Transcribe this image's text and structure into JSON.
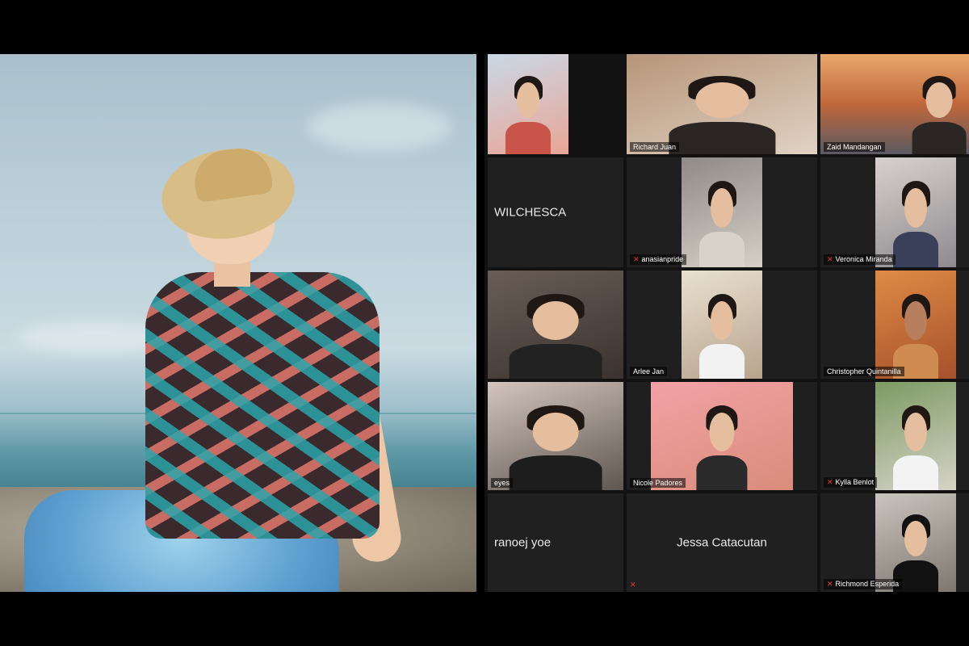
{
  "zoom": {
    "tiles": [
      {
        "id": "t1",
        "label": "",
        "mode": "video"
      },
      {
        "id": "t2",
        "label": "Richard Juan",
        "mode": "video"
      },
      {
        "id": "t3",
        "label": "Zaid Mandangan",
        "mode": "video"
      },
      {
        "id": "t4",
        "label": "WILCHESCA",
        "mode": "name"
      },
      {
        "id": "t5",
        "label": "anasianpride",
        "mode": "video",
        "muted": true
      },
      {
        "id": "t6",
        "label": "Veronica Miranda",
        "mode": "video",
        "muted": true
      },
      {
        "id": "t7",
        "label": "",
        "mode": "video"
      },
      {
        "id": "t8",
        "label": "Arlee Jan",
        "mode": "video"
      },
      {
        "id": "t9",
        "label": "Christopher Quintanilla",
        "mode": "video"
      },
      {
        "id": "t10",
        "label": "eyes",
        "mode": "video"
      },
      {
        "id": "t11",
        "label": "Nicole Padores",
        "mode": "video"
      },
      {
        "id": "t12",
        "label": "Kylla Benlot",
        "mode": "video",
        "muted": true
      },
      {
        "id": "t13",
        "label": "ranoej yoe",
        "mode": "name"
      },
      {
        "id": "t14",
        "label": "Jessa Catacutan",
        "mode": "name",
        "muted": true
      },
      {
        "id": "t15",
        "label": "Richmond Esperida",
        "mode": "video",
        "muted": true
      }
    ]
  }
}
